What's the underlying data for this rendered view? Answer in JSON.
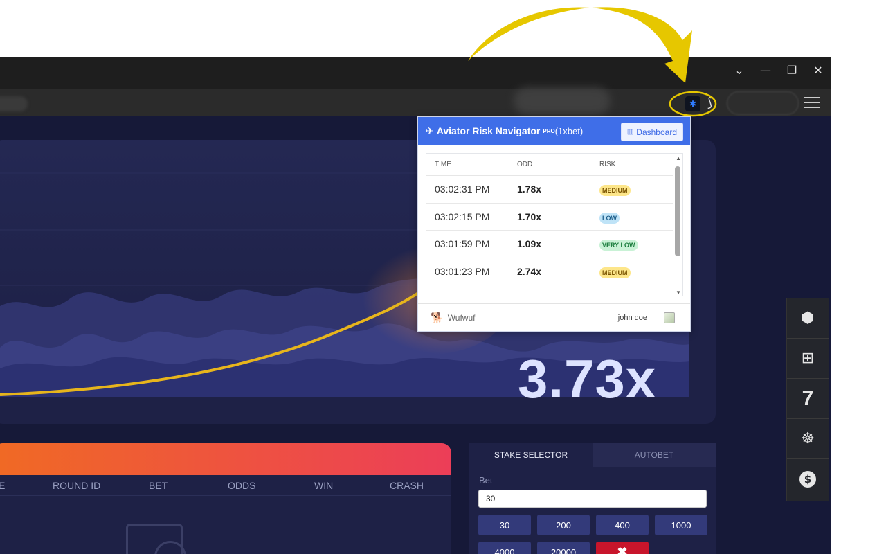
{
  "window": {
    "controls": [
      "⌄",
      "—",
      "❐",
      "✕"
    ]
  },
  "toolbar": {
    "extension_icon": "puzzle-extension-icon",
    "menu_icon": "hamburger-menu-icon"
  },
  "game": {
    "multiplier": "3.73x"
  },
  "right_rail": {
    "items": [
      {
        "icon": "info-shield-icon",
        "glyph": "!"
      },
      {
        "icon": "gift-icon",
        "glyph": "🎁"
      },
      {
        "icon": "seven-icon",
        "glyph": "7"
      },
      {
        "icon": "wheel-icon",
        "glyph": "☸"
      },
      {
        "icon": "dollar-icon",
        "glyph": "$"
      }
    ]
  },
  "history": {
    "columns": [
      "E",
      "ROUND ID",
      "BET",
      "ODDS",
      "WIN",
      "CRASH"
    ]
  },
  "stake": {
    "tabs": [
      "STAKE SELECTOR",
      "AUTOBET"
    ],
    "bet_label": "Bet",
    "bet_value": "30",
    "chips": [
      "30",
      "200",
      "400",
      "1000",
      "4000",
      "20000",
      "✖"
    ]
  },
  "popup": {
    "plane": "✈",
    "title": "Aviator Risk Navigator",
    "pro": "PRO",
    "bookmaker": "(1xbet)",
    "dashboard_label": "Dashboard",
    "columns": {
      "time": "TIME",
      "odd": "ODD",
      "risk": "RISK"
    },
    "rows": [
      {
        "time": "03:02:31 PM",
        "odd": "1.78x",
        "risk": "MEDIUM",
        "color": "#fde68a",
        "text_color": "#7a5300"
      },
      {
        "time": "03:02:15 PM",
        "odd": "1.70x",
        "risk": "LOW",
        "color": "#bfe3f7",
        "text_color": "#1d5f8c"
      },
      {
        "time": "03:01:59 PM",
        "odd": "1.09x",
        "risk": "VERY LOW",
        "color": "#c9f2d6",
        "text_color": "#177a3a"
      },
      {
        "time": "03:01:23 PM",
        "odd": "2.74x",
        "risk": "MEDIUM",
        "color": "#fde68a",
        "text_color": "#7a5300"
      }
    ],
    "brand": "Wufwuf",
    "user": "john doe"
  },
  "colors": {
    "accent_blue": "#3f6ee8",
    "annotation_yellow": "#e6c700",
    "history_gradient_start": "#f06a24",
    "history_gradient_end": "#ec3e58",
    "clear_red": "#c8152b"
  }
}
